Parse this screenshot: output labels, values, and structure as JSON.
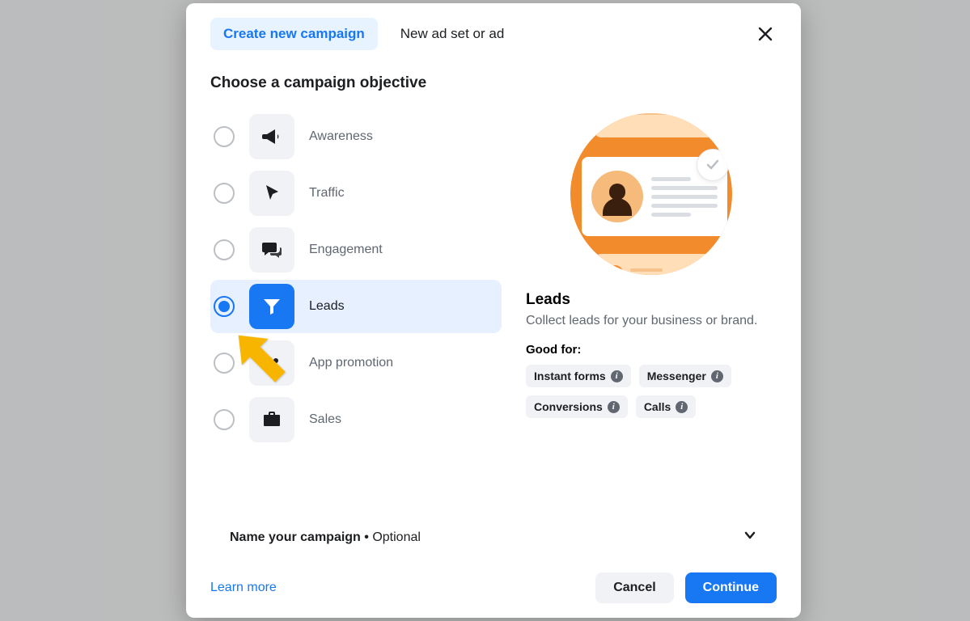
{
  "tabs": {
    "create": "Create new campaign",
    "new_adset": "New ad set or ad"
  },
  "section_title": "Choose a campaign objective",
  "objectives": [
    {
      "key": "awareness",
      "label": "Awareness",
      "icon": "megaphone",
      "selected": false
    },
    {
      "key": "traffic",
      "label": "Traffic",
      "icon": "cursor",
      "selected": false
    },
    {
      "key": "engagement",
      "label": "Engagement",
      "icon": "chat",
      "selected": false
    },
    {
      "key": "leads",
      "label": "Leads",
      "icon": "funnel",
      "selected": true
    },
    {
      "key": "app_promotion",
      "label": "App promotion",
      "icon": "people",
      "selected": false
    },
    {
      "key": "sales",
      "label": "Sales",
      "icon": "briefcase",
      "selected": false
    }
  ],
  "detail": {
    "title": "Leads",
    "description": "Collect leads for your business or brand.",
    "good_for_label": "Good for:",
    "tags": [
      "Instant forms",
      "Messenger",
      "Conversions",
      "Calls"
    ]
  },
  "name_row": {
    "label": "Name your campaign",
    "optional": "Optional"
  },
  "footer": {
    "learn_more": "Learn more",
    "cancel": "Cancel",
    "continue": "Continue"
  }
}
